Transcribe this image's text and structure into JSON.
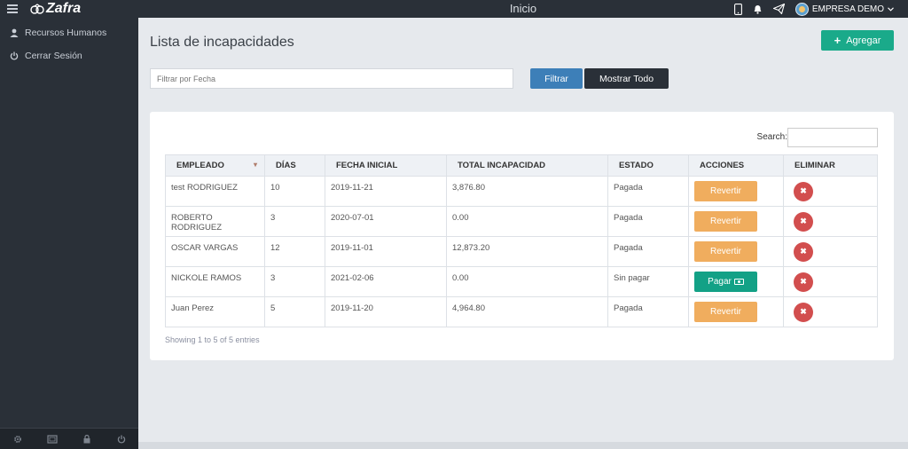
{
  "brand": {
    "name": "Zafra"
  },
  "topbar": {
    "title": "Inicio",
    "company": "EMPRESA DEMO"
  },
  "sidebar": {
    "items": [
      {
        "label": "Recursos Humanos",
        "icon": "user-icon"
      },
      {
        "label": "Cerrar Sesión",
        "icon": "power-icon"
      }
    ],
    "footer_icons": [
      "gear-icon",
      "fullscreen-icon",
      "lock-icon",
      "power-icon"
    ]
  },
  "main": {
    "title": "Lista de incapacidades",
    "add_label": "Agregar",
    "filter_placeholder": "Filtrar por Fecha",
    "filter_label": "Filtrar",
    "show_all_label": "Mostrar Todo",
    "search_label": "Search:",
    "showing": "Showing 1 to 5 of 5 entries"
  },
  "table": {
    "headers": [
      "EMPLEADO",
      "DÍAS",
      "FECHA INICIAL",
      "TOTAL INCAPACIDAD",
      "ESTADO",
      "ACCIONES",
      "ELIMINAR"
    ],
    "rows": [
      {
        "empleado": "test RODRIGUEZ",
        "dias": "10",
        "fecha": "2019-11-21",
        "total": "3,876.80",
        "estado": "Pagada",
        "accion": "Revertir"
      },
      {
        "empleado": "ROBERTO RODRIGUEZ",
        "dias": "3",
        "fecha": "2020-07-01",
        "total": "0.00",
        "estado": "Pagada",
        "accion": "Revertir"
      },
      {
        "empleado": "OSCAR VARGAS",
        "dias": "12",
        "fecha": "2019-11-01",
        "total": "12,873.20",
        "estado": "Pagada",
        "accion": "Revertir"
      },
      {
        "empleado": "NICKOLE RAMOS",
        "dias": "3",
        "fecha": "2021-02-06",
        "total": "0.00",
        "estado": "Sin pagar",
        "accion": "Pagar"
      },
      {
        "empleado": "Juan Perez",
        "dias": "5",
        "fecha": "2019-11-20",
        "total": "4,964.80",
        "estado": "Pagada",
        "accion": "Revertir"
      }
    ]
  },
  "colors": {
    "accent": "#1aaa8a",
    "primary": "#3d7fb8",
    "warning": "#f0ad5e",
    "danger": "#d24e4e",
    "sidebar": "#2a3038"
  }
}
